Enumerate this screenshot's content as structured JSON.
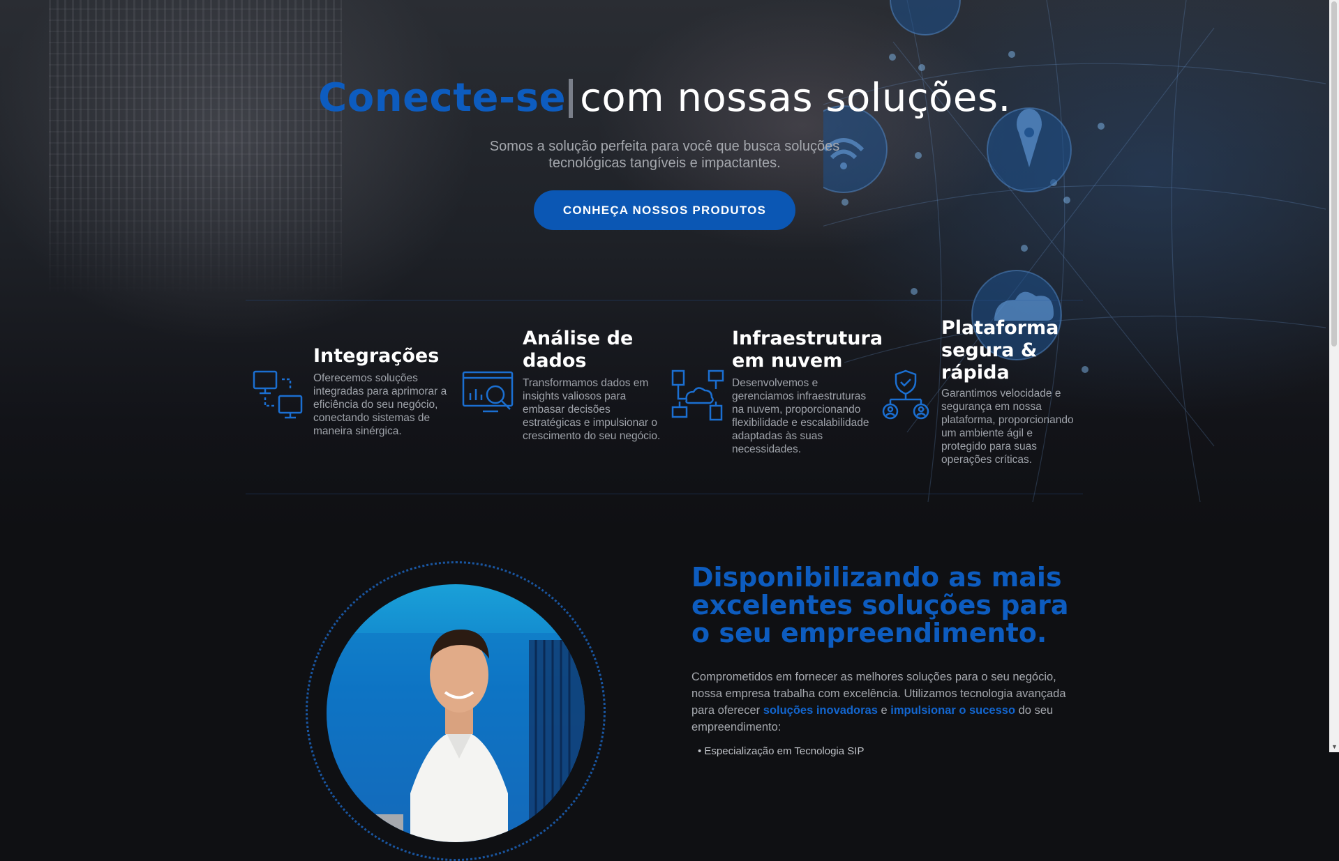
{
  "hero": {
    "title_accent": "Conecte-se",
    "title_rest": "com nossas soluções.",
    "subtitle_line1": "Somos a solução perfeita para você que busca soluções",
    "subtitle_line2": "tecnológicas tangíveis e impactantes.",
    "cta_label": "CONHEÇA NOSSOS PRODUTOS"
  },
  "features": [
    {
      "icon": "monitor-sync-icon",
      "title": "Integrações",
      "text": "Oferecemos soluções integradas para aprimorar a eficiência do seu negócio, conectando sistemas de maneira sinérgica."
    },
    {
      "icon": "data-analysis-icon",
      "title": "Análise de dados",
      "text": "Transformamos dados em insights valiosos para embasar decisões estratégicas e impulsionar o crescimento do seu negócio."
    },
    {
      "icon": "cloud-network-icon",
      "title": "Infraestrutura em nuvem",
      "text": "Desenvolvemos e gerenciamos infraestruturas na nuvem, proporcionando flexibilidade e escalabilidade adaptadas às suas necessidades."
    },
    {
      "icon": "secure-users-icon",
      "title": "Plataforma segura & rápida",
      "text": "Garantimos velocidade e segurança em nossa plataforma, proporcionando um ambiente ágil e protegido para suas operações críticas."
    }
  ],
  "about": {
    "title": "Disponibilizando as mais excelentes soluções para o seu empreendimento.",
    "body_1": "Comprometidos em fornecer as melhores soluções para o seu negócio, nossa empresa trabalha com excelência. Utilizamos tecnologia avançada para oferecer ",
    "highlight_1": "soluções inovadoras",
    "body_2": " e ",
    "highlight_2": "impulsionar o sucesso",
    "body_3": " do seu empreendimento:",
    "bullet_1": "Especialização em Tecnologia SIP"
  },
  "colors": {
    "accent": "#0d5cbf",
    "button": "#0b57b4",
    "background": "#0f1013"
  }
}
